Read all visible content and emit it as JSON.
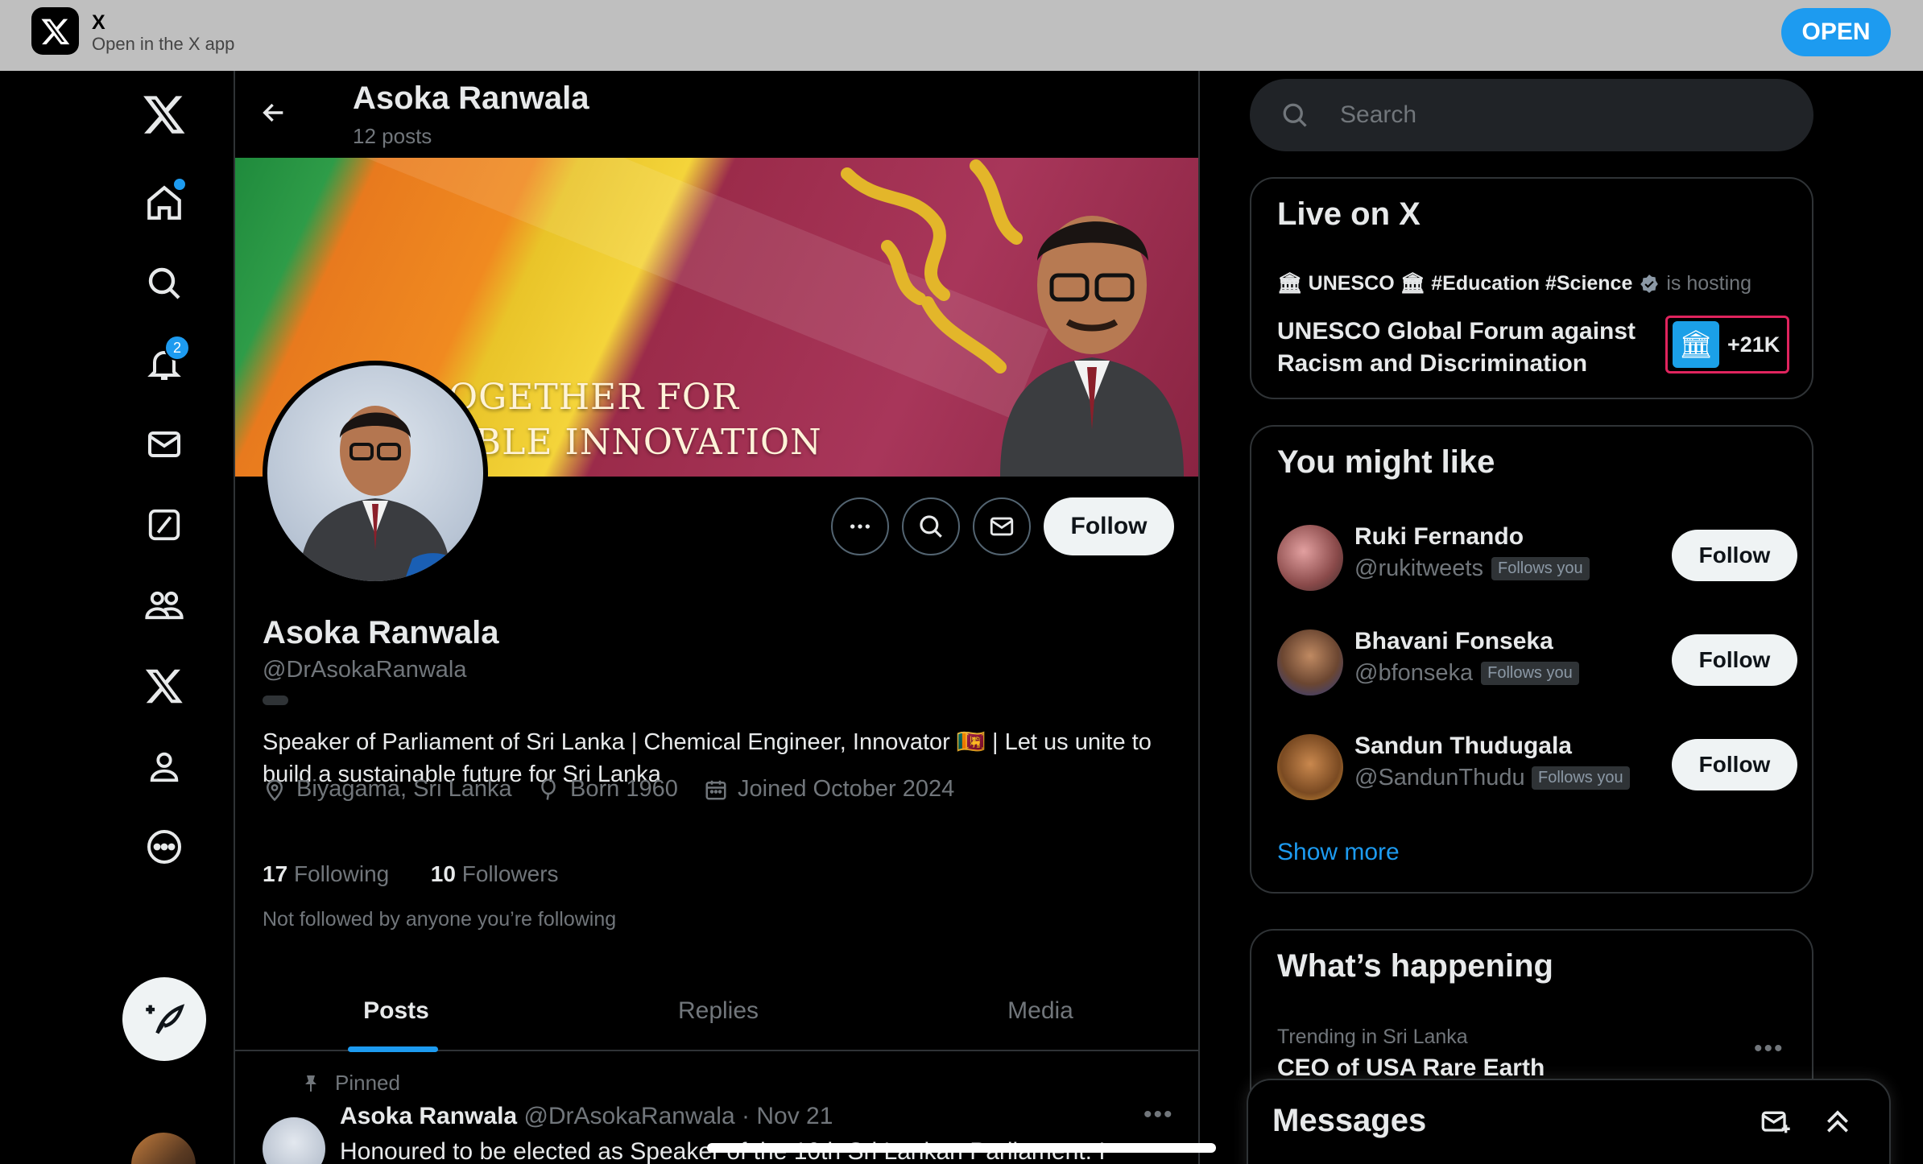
{
  "banner": {
    "app_name": "X",
    "subtitle": "Open in the X app",
    "open_label": "OPEN"
  },
  "nav": {
    "notifications_badge": "2",
    "icons": [
      "x-logo-icon",
      "home-icon",
      "search-icon",
      "bell-icon",
      "mail-icon",
      "grok-icon",
      "communities-icon",
      "x-premium-icon",
      "profile-icon",
      "more-icon",
      "compose-icon"
    ]
  },
  "header": {
    "name": "Asoka Ranwala",
    "posts_count": "12 posts"
  },
  "profile_banner": {
    "headline_line1": "OGETHER FOR",
    "headline_line2": "ABLE INNOVATION"
  },
  "profile": {
    "name": "Asoka Ranwala",
    "handle": "@DrAsokaRanwala",
    "bio": "Speaker of Parliament of Sri Lanka | Chemical Engineer, Innovator 🇱🇰 | Let us unite to build a sustainable future for Sri Lanka",
    "location": "Biyagama, Sri Lanka",
    "born": "Born 1960",
    "joined": "Joined October 2024",
    "following_count": "17",
    "following_label": "Following",
    "followers_count": "10",
    "followers_label": "Followers",
    "not_followed": "Not followed by anyone you’re following",
    "follow_label": "Follow"
  },
  "tabs": [
    {
      "label": "Posts",
      "active": true
    },
    {
      "label": "Replies",
      "active": false
    },
    {
      "label": "Media",
      "active": false
    }
  ],
  "pinned_post": {
    "pinned_label": "Pinned",
    "author_name": "Asoka Ranwala",
    "author_handle": "@DrAsokaRanwala",
    "date": "· Nov 21",
    "text": "Honoured to be elected as Speaker of the 10th Sri Lankan Parliament. I"
  },
  "search": {
    "placeholder": "Search"
  },
  "live": {
    "heading": "Live on X",
    "host": "🏛 UNESCO 🏛 #Education #Science",
    "host_suffix": "is hosting",
    "title": "UNESCO Global Forum against Racism and Discrimination",
    "listeners": "+21K"
  },
  "who_to_follow": {
    "heading": "You might like",
    "follows_you_label": "Follows you",
    "follow_label": "Follow",
    "show_more": "Show more",
    "users": [
      {
        "name": "Ruki Fernando",
        "handle": "@rukitweets"
      },
      {
        "name": "Bhavani Fonseka",
        "handle": "@bfonseka"
      },
      {
        "name": "Sandun Thudugala",
        "handle": "@SandunThudu"
      }
    ]
  },
  "trends": {
    "heading": "What’s happening",
    "context": "Trending in Sri Lanka",
    "title": "CEO of USA Rare Earth"
  },
  "messages": {
    "title": "Messages"
  },
  "colors": {
    "accent": "#1d9bf0",
    "background": "#000000",
    "text": "#e7e9ea",
    "muted": "#71767b",
    "border": "#2f3336",
    "highlight": "#e0245e"
  }
}
